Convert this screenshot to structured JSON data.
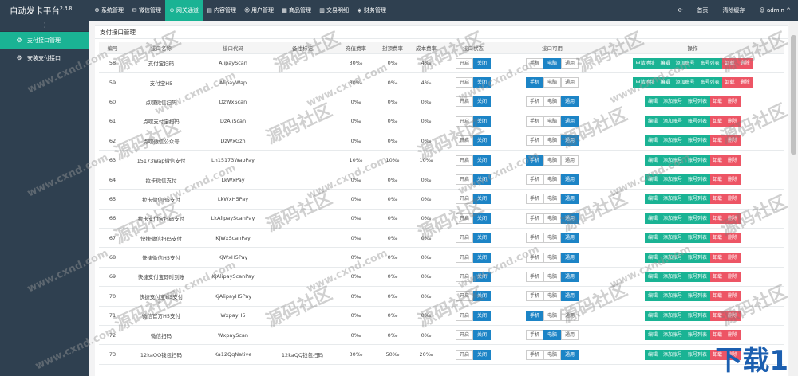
{
  "app": {
    "title": "自动发卡平台",
    "version": "2.3.8"
  },
  "topnav": [
    {
      "label": "系统管理",
      "icon": "gear-icon",
      "glyph": "⚙",
      "active": false
    },
    {
      "label": "微信管理",
      "icon": "wechat-icon",
      "glyph": "✉",
      "active": false
    },
    {
      "label": "网关通道",
      "icon": "gateway-icon",
      "glyph": "⊕",
      "active": true
    },
    {
      "label": "内容管理",
      "icon": "content-icon",
      "glyph": "▤",
      "active": false
    },
    {
      "label": "用户管理",
      "icon": "users-icon",
      "glyph": "☺",
      "active": false
    },
    {
      "label": "商品管理",
      "icon": "goods-icon",
      "glyph": "▦",
      "active": false
    },
    {
      "label": "交易明细",
      "icon": "chart-icon",
      "glyph": "▥",
      "active": false
    },
    {
      "label": "财务管理",
      "icon": "finance-icon",
      "glyph": "◈",
      "active": false
    }
  ],
  "topright": {
    "refresh_icon": "refresh-icon",
    "home": "首页",
    "clear_cache": "清除缓存",
    "user": "admin ^"
  },
  "sidebar": {
    "toggle": "⋮",
    "items": [
      {
        "label": "支付接口管理",
        "icon": "gear-icon",
        "active": true
      },
      {
        "label": "安装支付接口",
        "icon": "gear-icon",
        "active": false
      }
    ]
  },
  "panel": {
    "title": "支付接口管理"
  },
  "table": {
    "headers": [
      "编号",
      "接口名称",
      "接口代码",
      "备注标记",
      "充值费率",
      "封顶费率",
      "成本费率",
      "接口状态",
      "接口可用",
      "操作"
    ],
    "state_labels": {
      "on": "开启",
      "off": "关闭",
      "mobile": "手机",
      "pc": "电脑",
      "common": "通用"
    },
    "op_labels": {
      "apply": "申请地址",
      "edit": "编辑",
      "add_account": "添加账号",
      "account_list": "账号列表",
      "uninstall": "卸载",
      "delete": "删除"
    },
    "rows": [
      {
        "id": "58",
        "name": "支付宝扫码",
        "code": "AlipayScan",
        "remark": "",
        "rate": "30‰",
        "cap": "0‰",
        "cost": "4‰",
        "usable": "pc",
        "apply": true
      },
      {
        "id": "59",
        "name": "支付宝H5",
        "code": "AlipayWap",
        "remark": "",
        "rate": "30‰",
        "cap": "0‰",
        "cost": "4‰",
        "usable": "mobile",
        "apply": true
      },
      {
        "id": "60",
        "name": "点嘿微信扫码",
        "code": "DzWxScan",
        "remark": "",
        "rate": "0‰",
        "cap": "0‰",
        "cost": "0‰",
        "usable": "common",
        "apply": false
      },
      {
        "id": "61",
        "name": "点嘿支付宝扫码",
        "code": "DzAliScan",
        "remark": "",
        "rate": "0‰",
        "cap": "0‰",
        "cost": "0‰",
        "usable": "common",
        "apply": false
      },
      {
        "id": "62",
        "name": "点嘿微信公众号",
        "code": "DzWxGzh",
        "remark": "",
        "rate": "0‰",
        "cap": "0‰",
        "cost": "0‰",
        "usable": "common",
        "apply": false
      },
      {
        "id": "63",
        "name": "15173Wap微信支付",
        "code": "Lh15173WapPay",
        "remark": "",
        "rate": "10‰",
        "cap": "10‰",
        "cost": "10‰",
        "usable": "mobile",
        "apply": false
      },
      {
        "id": "64",
        "name": "拉卡微信支付",
        "code": "LkWxPay",
        "remark": "",
        "rate": "0‰",
        "cap": "0‰",
        "cost": "0‰",
        "usable": "common",
        "apply": false
      },
      {
        "id": "65",
        "name": "拉卡微信H5支付",
        "code": "LkWxH5Pay",
        "remark": "",
        "rate": "0‰",
        "cap": "0‰",
        "cost": "0‰",
        "usable": "common",
        "apply": false
      },
      {
        "id": "66",
        "name": "拉卡支付宝扫码支付",
        "code": "LkAlipayScanPay",
        "remark": "",
        "rate": "0‰",
        "cap": "0‰",
        "cost": "0‰",
        "usable": "common",
        "apply": false
      },
      {
        "id": "67",
        "name": "快捷微信扫码支付",
        "code": "KjWxScanPay",
        "remark": "",
        "rate": "0‰",
        "cap": "0‰",
        "cost": "0‰",
        "usable": "common",
        "apply": false
      },
      {
        "id": "68",
        "name": "快捷微信H5支付",
        "code": "KjWxH5Pay",
        "remark": "",
        "rate": "0‰",
        "cap": "0‰",
        "cost": "0‰",
        "usable": "common",
        "apply": false
      },
      {
        "id": "69",
        "name": "快捷支付宝即时到账",
        "code": "KjAlipayScanPay",
        "remark": "",
        "rate": "0‰",
        "cap": "0‰",
        "cost": "0‰",
        "usable": "common",
        "apply": false
      },
      {
        "id": "70",
        "name": "快捷支付宝H5支付",
        "code": "KjAlipayH5Pay",
        "remark": "",
        "rate": "0‰",
        "cap": "0‰",
        "cost": "0‰",
        "usable": "common",
        "apply": false
      },
      {
        "id": "71",
        "name": "微信官方H5支付",
        "code": "WxpayH5",
        "remark": "",
        "rate": "0‰",
        "cap": "0‰",
        "cost": "0‰",
        "usable": "mobile",
        "apply": false
      },
      {
        "id": "72",
        "name": "微信扫码",
        "code": "WxpayScan",
        "remark": "",
        "rate": "0‰",
        "cap": "0‰",
        "cost": "0‰",
        "usable": "pc",
        "apply": false
      },
      {
        "id": "73",
        "name": "12kaQQ钱包扫码",
        "code": "Ka12QqNative",
        "remark": "12kaQQ钱包扫码",
        "rate": "30‰",
        "cap": "50‰",
        "cost": "20‰",
        "usable": "common",
        "apply": false
      }
    ]
  },
  "watermarks": {
    "site": "www.cxnd.com",
    "community": "源码社区",
    "corner": "下载1"
  },
  "colors": {
    "nav_bg": "#2f4050",
    "accent": "#1ab394",
    "primary": "#1c84c6",
    "danger": "#ed5565",
    "warning": "#f8ac59"
  }
}
